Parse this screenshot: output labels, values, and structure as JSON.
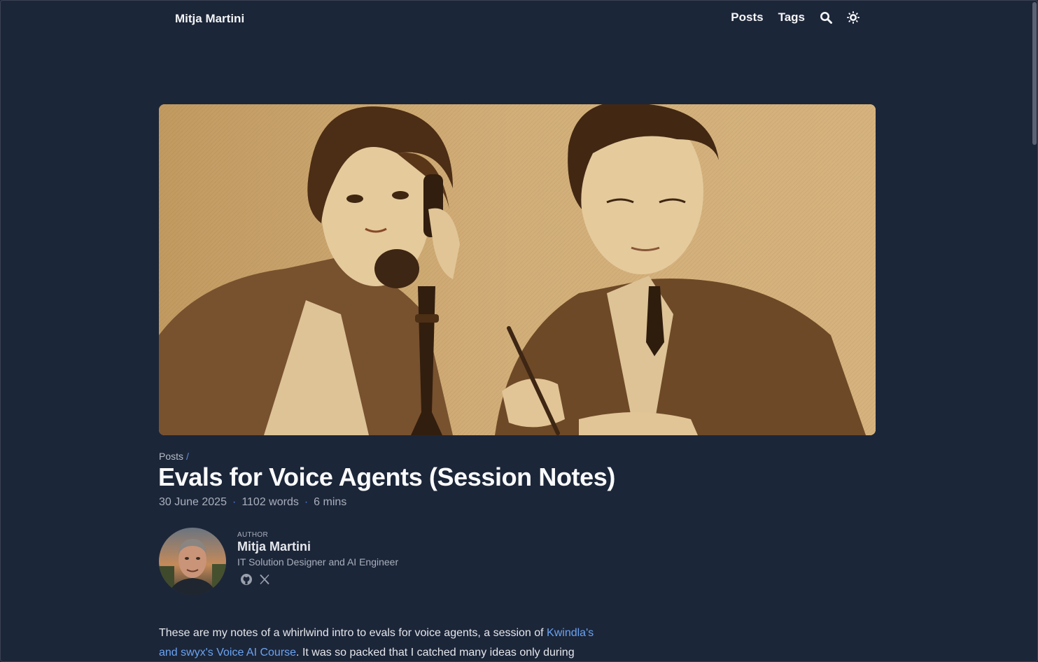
{
  "header": {
    "brand": "Mitja Martini",
    "nav": [
      "Posts",
      "Tags"
    ],
    "icons": [
      "search-icon",
      "theme-toggle-icon"
    ]
  },
  "hero": {
    "alt": ""
  },
  "breadcrumb": {
    "label": "Posts",
    "separator": "/"
  },
  "article": {
    "title": "Evals for Voice Agents (Session Notes)",
    "date": "30 June 2025",
    "words": "1102 words",
    "read_time": "6 mins",
    "meta_separator": "·"
  },
  "author": {
    "kicker": "AUTHOR",
    "name": "Mitja Martini",
    "role": "IT Solution Designer and AI Engineer",
    "socials": [
      "github-icon",
      "x-icon"
    ]
  },
  "body": {
    "p1_before": "These are my notes of a whirlwind intro to evals for voice agents, a session of ",
    "p1_link": "Kwindla's and swyx's Voice AI Course",
    "p1_after": ". It was so packed that I catched many ideas only during"
  },
  "colors": {
    "background": "#1c2639",
    "accent": "#6aa3f0",
    "hero_sepia": "#d5ad6f"
  }
}
